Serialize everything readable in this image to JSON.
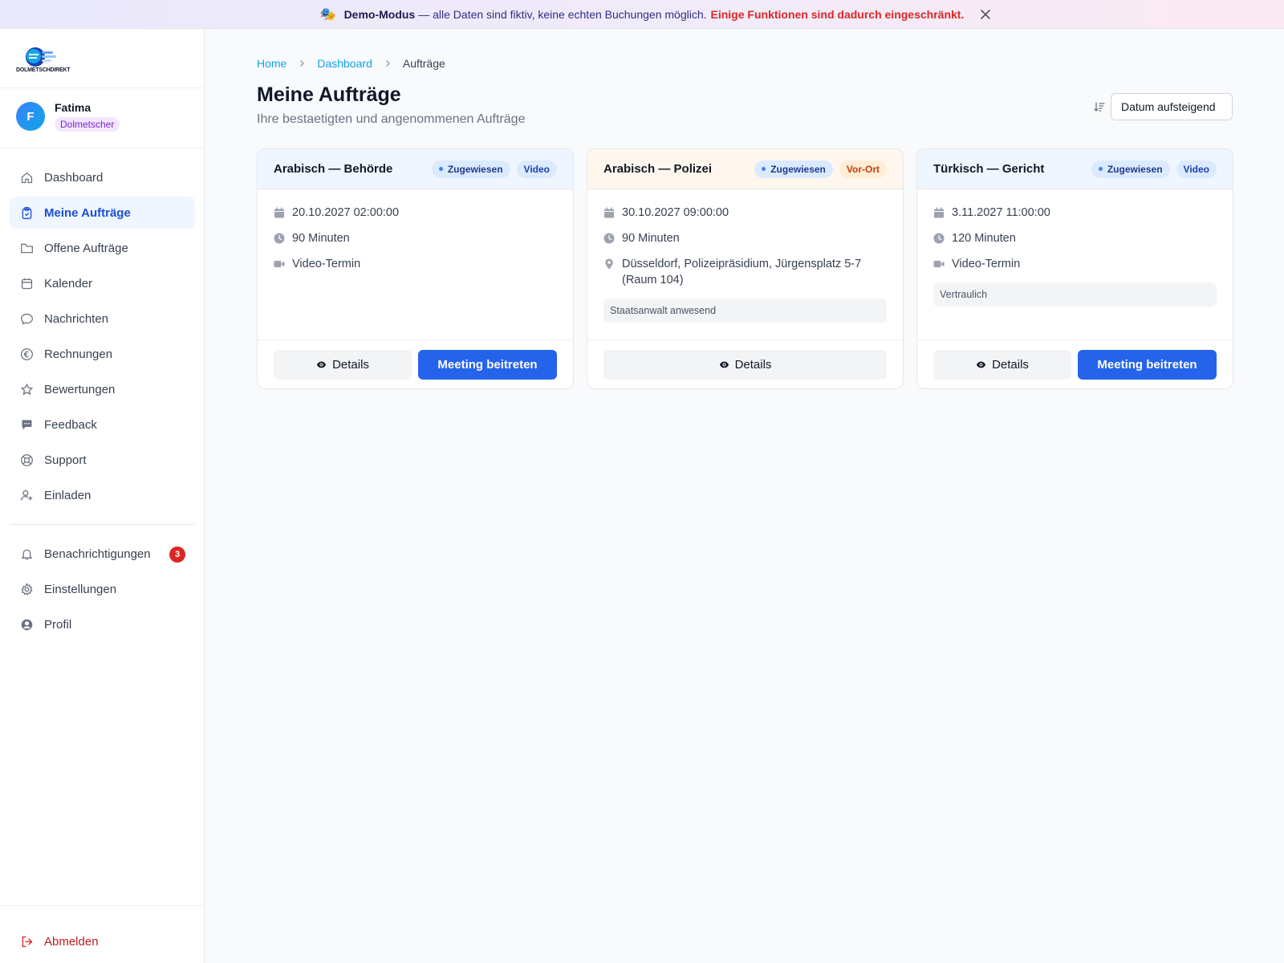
{
  "banner": {
    "strong": "Demo-Modus",
    "text": "— alle Daten sind fiktiv, keine echten Buchungen möglich.",
    "warning": "Einige Funktionen sind dadurch eingeschränkt.",
    "icon": "mask-icon"
  },
  "brand": {
    "logo_text": "DOLMETSCHDIREKT"
  },
  "user": {
    "initial": "F",
    "name": "Fatima",
    "role": "Dolmetscher"
  },
  "nav": {
    "items": [
      {
        "label": "Dashboard",
        "icon": "home-icon"
      },
      {
        "label": "Meine Aufträge",
        "icon": "clipboard-icon",
        "active": true
      },
      {
        "label": "Offene Aufträge",
        "icon": "folder-icon"
      },
      {
        "label": "Kalender",
        "icon": "calendar-icon"
      },
      {
        "label": "Nachrichten",
        "icon": "chat-icon"
      },
      {
        "label": "Rechnungen",
        "icon": "euro-icon"
      },
      {
        "label": "Bewertungen",
        "icon": "star-icon"
      },
      {
        "label": "Feedback",
        "icon": "feedback-icon"
      },
      {
        "label": "Support",
        "icon": "lifebuoy-icon"
      },
      {
        "label": "Einladen",
        "icon": "user-plus-icon"
      }
    ],
    "secondary": [
      {
        "label": "Benachrichtigungen",
        "icon": "bell-icon",
        "badge": "3"
      },
      {
        "label": "Einstellungen",
        "icon": "gear-icon"
      },
      {
        "label": "Profil",
        "icon": "user-circle-icon"
      }
    ],
    "logout": "Abmelden"
  },
  "breadcrumb": {
    "home": "Home",
    "dashboard": "Dashboard",
    "current": "Aufträge"
  },
  "page": {
    "title": "Meine Aufträge",
    "subtitle": "Ihre bestaetigten und angenommenen Aufträge",
    "sort_label": "Datum aufsteigend"
  },
  "orders": [
    {
      "title": "Arabisch — Behörde",
      "status": "Zugewiesen",
      "type": "Video",
      "date": "20.10.2027 02:00:00",
      "duration": "90 Minuten",
      "location": "Video-Termin",
      "note": "",
      "details_label": "Details",
      "join_label": "Meeting beitreten"
    },
    {
      "title": "Arabisch — Polizei",
      "status": "Zugewiesen",
      "type": "Vor-Ort",
      "date": "30.10.2027 09:00:00",
      "duration": "90 Minuten",
      "location": "Düsseldorf, Polizeipräsidium, Jürgensplatz 5-7 (Raum 104)",
      "note": "Staatsanwalt anwesend",
      "details_label": "Details",
      "join_label": ""
    },
    {
      "title": "Türkisch — Gericht",
      "status": "Zugewiesen",
      "type": "Video",
      "date": "3.11.2027 11:00:00",
      "duration": "120 Minuten",
      "location": "Video-Termin",
      "note": "Vertraulich",
      "details_label": "Details",
      "join_label": "Meeting beitreten"
    }
  ],
  "colors": {
    "accent": "#2563eb",
    "link": "#0ea5e9",
    "danger": "#dc2626",
    "active_bg": "#eff6ff"
  }
}
